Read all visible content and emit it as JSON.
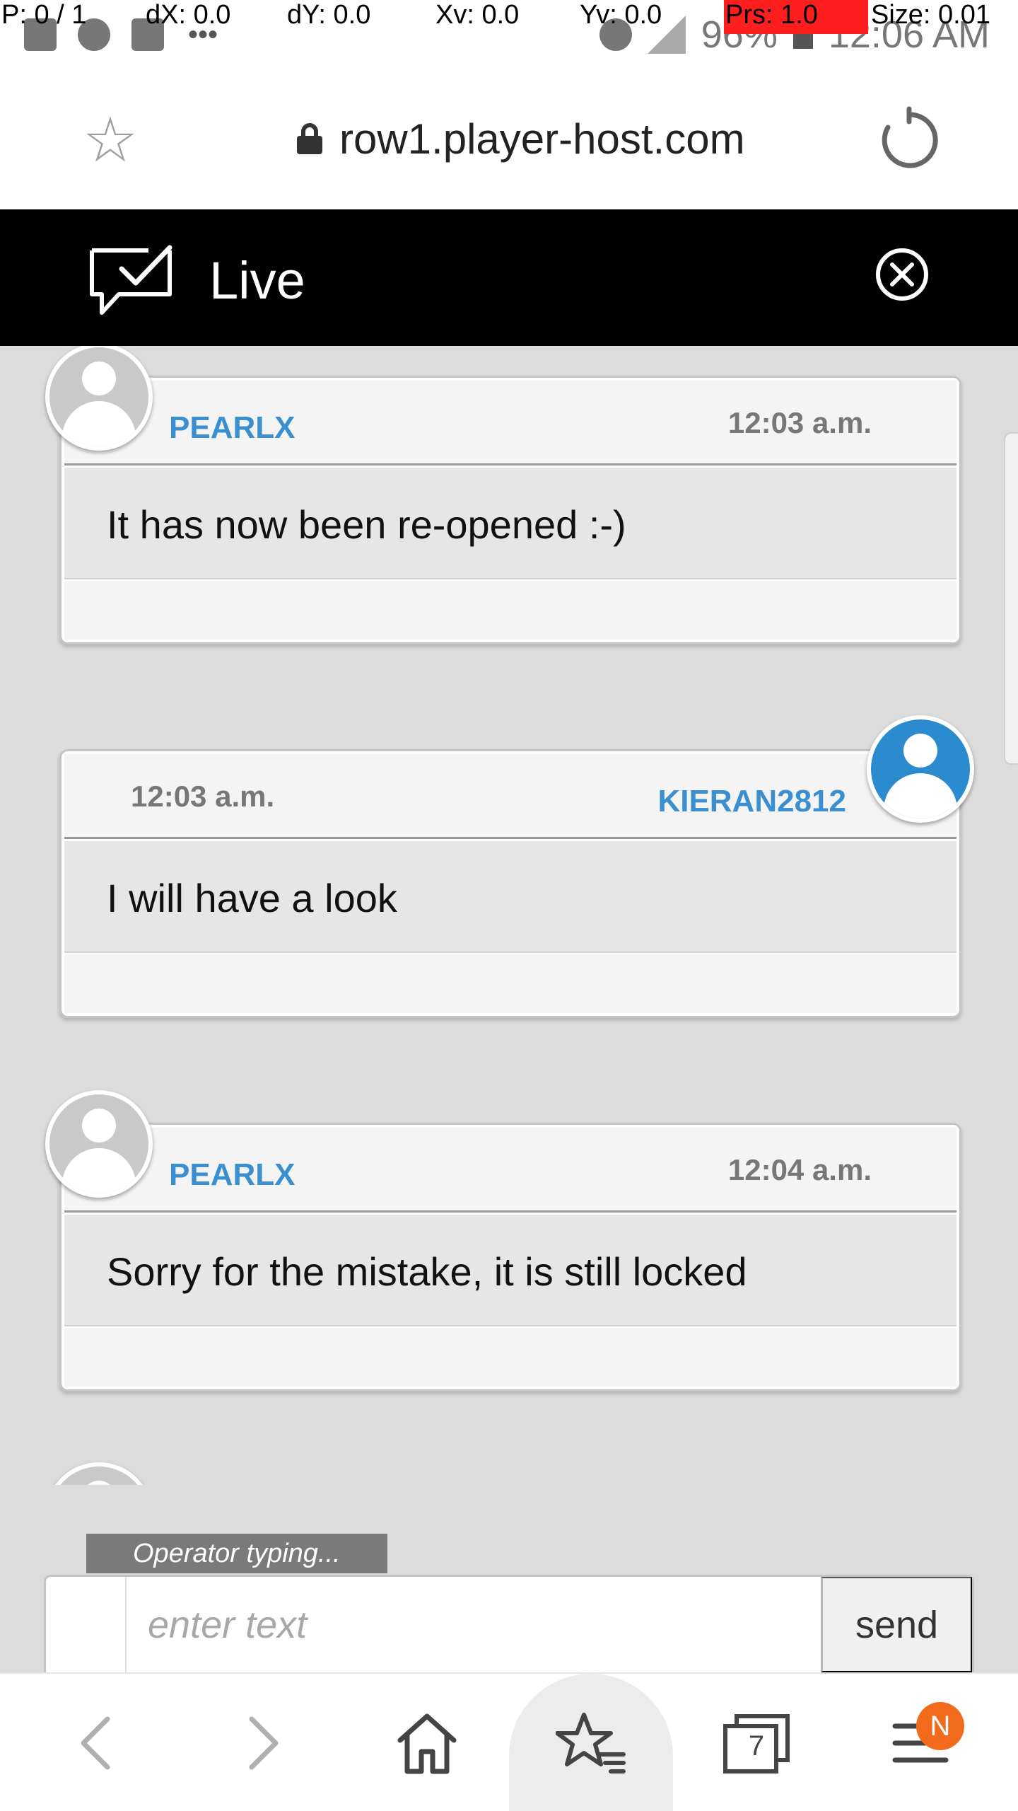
{
  "debug": {
    "p": "P: 0 / 1",
    "dx": "dX: 0.0",
    "dy": "dY: 0.0",
    "xv": "Xv: 0.0",
    "yv": "Yv: 0.0",
    "prs": "Prs: 1.0",
    "size": "Size: 0.01"
  },
  "status_bar": {
    "battery": "96%",
    "time": "12:06 AM",
    "icons_left": [
      "gallery-icon",
      "messenger-icon",
      "flipboard-icon",
      "more-dots"
    ],
    "icons_right": [
      "alarm-icon",
      "data-icon",
      "signal-icon",
      "battery-icon"
    ]
  },
  "browser": {
    "url": "row1.player-host.com"
  },
  "chat": {
    "title": "Live",
    "messages": [
      {
        "user": "PEARLX",
        "time": "12:03 a.m.",
        "text": "It has now been re-opened :-)",
        "side": "left"
      },
      {
        "user": "KIERAN2812",
        "time": "12:03 a.m.",
        "text": "I will have a look",
        "side": "right"
      },
      {
        "user": "PEARLX",
        "time": "12:04 a.m.",
        "text": "Sorry for the mistake, it is still locked",
        "side": "left"
      }
    ],
    "typing": "Operator typing...",
    "input_placeholder": "enter text",
    "send_label": "send"
  },
  "bottom_nav": {
    "tabs_count": "7",
    "notification": "N"
  },
  "colors": {
    "accent_blue": "#3a8fd0",
    "badge_orange": "#f26b1d",
    "header_black": "#000000"
  }
}
